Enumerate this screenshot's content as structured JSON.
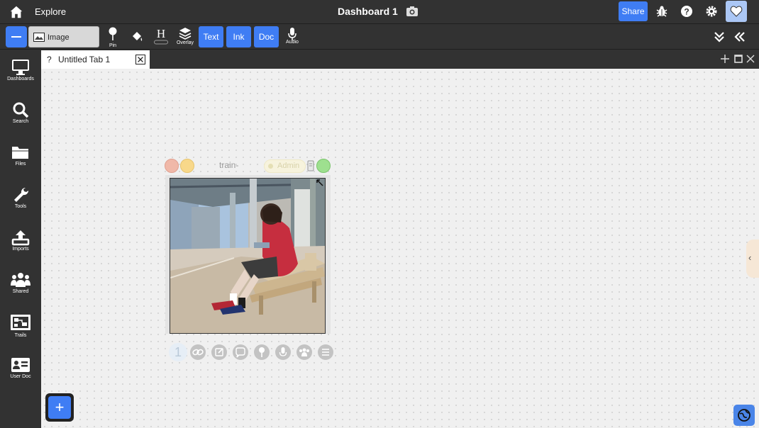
{
  "header": {
    "explore_label": "Explore",
    "dashboard_title": "Dashboard 1",
    "share_label": "Share"
  },
  "toolbar": {
    "type_select_value": "Image",
    "pin_label": "Pin",
    "overlay_label": "Overlay",
    "audio_label": "Audio",
    "text_label": "Text",
    "ink_label": "Ink",
    "doc_label": "Doc"
  },
  "sidebar": {
    "items": [
      {
        "label": "Dashboards",
        "icon": "monitor-icon"
      },
      {
        "label": "Search",
        "icon": "search-icon"
      },
      {
        "label": "Files",
        "icon": "folder-icon"
      },
      {
        "label": "Tools",
        "icon": "wrench-icon"
      },
      {
        "label": "Imports",
        "icon": "upload-icon"
      },
      {
        "label": "Shared",
        "icon": "users-icon"
      },
      {
        "label": "Trails",
        "icon": "trails-icon"
      },
      {
        "label": "User Doc",
        "icon": "user-card-icon"
      }
    ]
  },
  "tabs": [
    {
      "label": "Untitled Tab 1",
      "prefix": "?"
    }
  ],
  "document": {
    "title": "train-",
    "acl_label": "Admin",
    "link_count": "1"
  },
  "colors": {
    "accent": "#3f7df4",
    "chrome": "#323232",
    "canvas": "#f0f0f0",
    "close_circle": "#f0b8a8",
    "minimize_circle": "#f8d88a",
    "lock_circle": "#9ee08f"
  }
}
